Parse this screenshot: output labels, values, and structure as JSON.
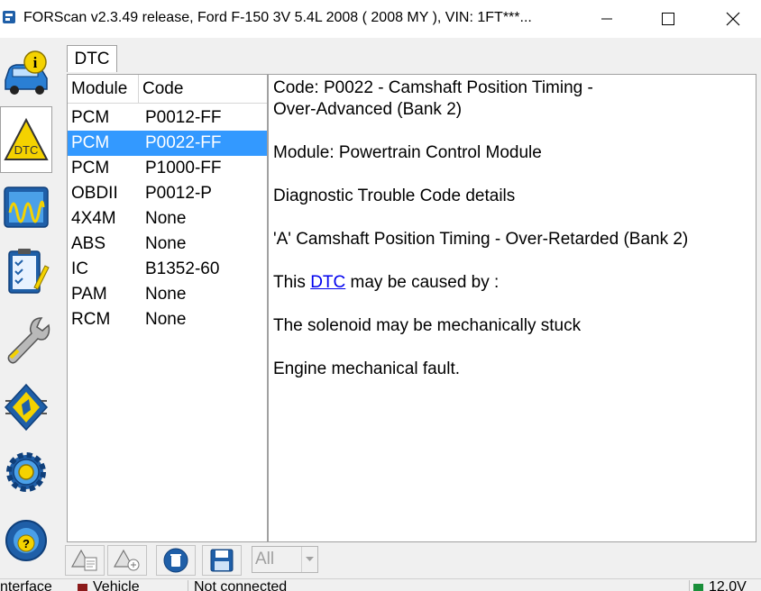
{
  "window": {
    "title": "FORScan v2.3.49 release, Ford F-150 3V 5.4L 2008 ( 2008 MY ), VIN: 1FT***..."
  },
  "sidebar": {
    "items": [
      {
        "name": "vehicle-info",
        "icon": "car-info-icon"
      },
      {
        "name": "dtc",
        "icon": "dtc-warning-icon",
        "active": true,
        "label": "DTC"
      },
      {
        "name": "oscilloscope",
        "icon": "oscilloscope-icon"
      },
      {
        "name": "checklist",
        "icon": "checklist-icon"
      },
      {
        "name": "service",
        "icon": "wrench-icon"
      },
      {
        "name": "configuration",
        "icon": "chip-icon"
      },
      {
        "name": "settings",
        "icon": "gear-icon"
      },
      {
        "name": "help",
        "icon": "help-steering-icon"
      }
    ]
  },
  "tab": {
    "label": "DTC"
  },
  "dtc_list": {
    "columns": [
      "Module",
      "Code"
    ],
    "rows": [
      {
        "module": "PCM",
        "code": "P0012-FF"
      },
      {
        "module": "PCM",
        "code": "P0022-FF",
        "selected": true
      },
      {
        "module": "PCM",
        "code": "P1000-FF"
      },
      {
        "module": "OBDII",
        "code": "P0012-P"
      },
      {
        "module": "4X4M",
        "code": "None"
      },
      {
        "module": "ABS",
        "code": "None"
      },
      {
        "module": "IC",
        "code": "B1352-60"
      },
      {
        "module": "PAM",
        "code": "None"
      },
      {
        "module": "RCM",
        "code": "None"
      }
    ]
  },
  "details": {
    "code_line1": "Code: P0022 - Camshaft Position Timing -",
    "code_line2": "Over-Advanced (Bank 2)",
    "module": "Module: Powertrain Control Module",
    "section": "Diagnostic Trouble Code details",
    "description": "'A' Camshaft Position Timing - Over-Retarded (Bank 2)",
    "cause_prefix": "This ",
    "cause_link": "DTC",
    "cause_suffix": " may be caused by :",
    "cause1": "The solenoid may be mechanically stuck",
    "cause2": "Engine mechanical fault."
  },
  "toolbar": {
    "filter_value": "All"
  },
  "status": {
    "seg1": "nterface",
    "seg2": "Vehicle",
    "seg3": "Not connected",
    "seg4": "12.0V"
  },
  "colors": {
    "selection": "#3399ff",
    "link": "#0000ee",
    "status_red": "#8b1a1a",
    "status_green": "#1a8f3a"
  }
}
